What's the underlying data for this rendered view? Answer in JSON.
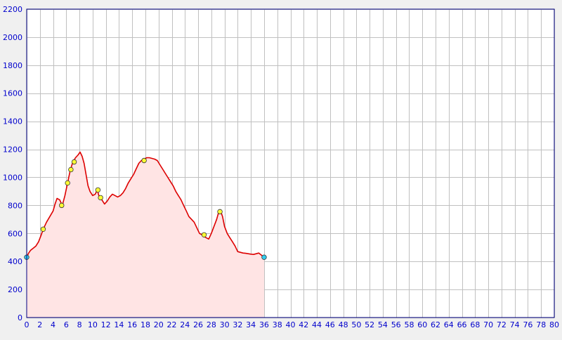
{
  "colors": {
    "background": "#f0f0f0",
    "plot_background": "#ffffff",
    "grid": "#c0c0c0",
    "axis_border": "#000080",
    "tick_text": "#0000cc",
    "line": "#dd0000",
    "fill": "#ffe4e4",
    "waypoint": "#ffff33",
    "endpoint": "#33ccee"
  },
  "chart_data": {
    "type": "area",
    "title": "",
    "xlabel": "",
    "ylabel": "",
    "xlim": [
      0,
      80
    ],
    "ylim": [
      0,
      2200
    ],
    "grid": true,
    "x_ticks": [
      0,
      2,
      4,
      6,
      8,
      10,
      12,
      14,
      16,
      18,
      20,
      22,
      24,
      26,
      28,
      30,
      32,
      34,
      36,
      38,
      40,
      42,
      44,
      46,
      48,
      50,
      52,
      54,
      56,
      58,
      60,
      62,
      64,
      66,
      68,
      70,
      72,
      74,
      76,
      78,
      80
    ],
    "y_ticks": [
      0,
      200,
      400,
      600,
      800,
      1000,
      1200,
      1400,
      1600,
      1800,
      2000,
      2200
    ],
    "series": [
      {
        "x": [
          0,
          0.3,
          0.6,
          1.0,
          1.4,
          1.8,
          2.2,
          2.5,
          3.0,
          3.5,
          4.0,
          4.3,
          4.6,
          5.0,
          5.4,
          5.8,
          6.2,
          6.6,
          7.0,
          7.4,
          7.8,
          8.1,
          8.4,
          8.7,
          9.0,
          9.3,
          9.6,
          10.0,
          10.4,
          10.7,
          11.0,
          11.4,
          11.8,
          12.2,
          12.6,
          13.0,
          13.4,
          13.8,
          14.2,
          14.6,
          15.0,
          15.4,
          15.8,
          16.2,
          16.6,
          17.0,
          17.4,
          17.8,
          18.2,
          18.6,
          19.0,
          19.4,
          19.8,
          20.2,
          20.6,
          21.0,
          21.4,
          21.8,
          22.2,
          22.6,
          23.0,
          23.4,
          23.8,
          24.2,
          24.6,
          25.0,
          25.4,
          25.8,
          26.2,
          26.6,
          26.9,
          27.2,
          27.6,
          28.0,
          28.4,
          28.8,
          29.1,
          29.4,
          29.7,
          30.0,
          30.4,
          30.8,
          31.2,
          31.6,
          32.0,
          32.4,
          32.8,
          33.2,
          33.6,
          34.0,
          34.4,
          34.8,
          35.2,
          35.6,
          36.0
        ],
        "values": [
          430,
          460,
          480,
          495,
          510,
          540,
          590,
          630,
          680,
          720,
          760,
          810,
          850,
          840,
          800,
          870,
          960,
          1050,
          1110,
          1140,
          1160,
          1180,
          1150,
          1100,
          1020,
          940,
          900,
          870,
          880,
          910,
          860,
          840,
          810,
          830,
          860,
          880,
          870,
          860,
          870,
          890,
          920,
          960,
          990,
          1020,
          1060,
          1100,
          1120,
          1130,
          1140,
          1140,
          1135,
          1130,
          1120,
          1090,
          1060,
          1030,
          1000,
          970,
          940,
          900,
          870,
          840,
          800,
          760,
          720,
          700,
          680,
          640,
          600,
          590,
          580,
          570,
          560,
          600,
          650,
          700,
          750,
          760,
          720,
          650,
          600,
          570,
          540,
          510,
          470,
          465,
          460,
          458,
          455,
          452,
          450,
          455,
          460,
          445,
          430
        ],
        "markers": [
          {
            "x": 0,
            "y": 430,
            "kind": "endpoint"
          },
          {
            "x": 2.5,
            "y": 630,
            "kind": "waypoint"
          },
          {
            "x": 5.3,
            "y": 800,
            "kind": "waypoint"
          },
          {
            "x": 6.2,
            "y": 960,
            "kind": "waypoint"
          },
          {
            "x": 6.7,
            "y": 1055,
            "kind": "waypoint"
          },
          {
            "x": 7.2,
            "y": 1110,
            "kind": "waypoint"
          },
          {
            "x": 10.8,
            "y": 910,
            "kind": "waypoint"
          },
          {
            "x": 11.2,
            "y": 855,
            "kind": "waypoint"
          },
          {
            "x": 17.8,
            "y": 1120,
            "kind": "waypoint"
          },
          {
            "x": 26.9,
            "y": 590,
            "kind": "waypoint"
          },
          {
            "x": 29.3,
            "y": 755,
            "kind": "waypoint"
          },
          {
            "x": 36.0,
            "y": 430,
            "kind": "endpoint"
          }
        ]
      }
    ]
  }
}
